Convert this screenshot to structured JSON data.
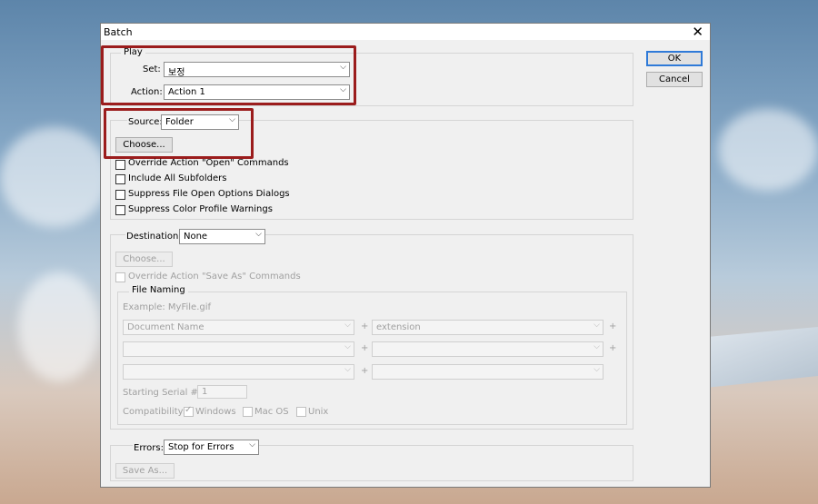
{
  "window": {
    "title": "Batch"
  },
  "buttons": {
    "ok": "OK",
    "cancel": "Cancel"
  },
  "play": {
    "legend": "Play",
    "set_label": "Set:",
    "set_value": "보정",
    "action_label": "Action:",
    "action_value": "Action 1"
  },
  "source": {
    "label": "Source:",
    "value": "Folder",
    "choose": "Choose...",
    "options": [
      "Override Action \"Open\" Commands",
      "Include All Subfolders",
      "Suppress File Open Options Dialogs",
      "Suppress Color Profile Warnings"
    ]
  },
  "destination": {
    "label": "Destination:",
    "value": "None",
    "choose": "Choose...",
    "override": "Override Action \"Save As\" Commands",
    "file_naming": {
      "legend": "File Naming",
      "example": "Example: MyFile.gif",
      "fields": [
        "Document Name",
        "extension",
        "",
        "",
        "",
        ""
      ],
      "plus": "+",
      "serial_label": "Starting Serial #:",
      "serial_value": "1",
      "compat_label": "Compatibility:",
      "windows": "Windows",
      "macos": "Mac OS",
      "unix": "Unix"
    }
  },
  "errors": {
    "label": "Errors:",
    "value": "Stop for Errors",
    "save_as": "Save As..."
  },
  "colors": {
    "highlight": "#9b1c1c",
    "default_button": "#2f7ad8"
  }
}
